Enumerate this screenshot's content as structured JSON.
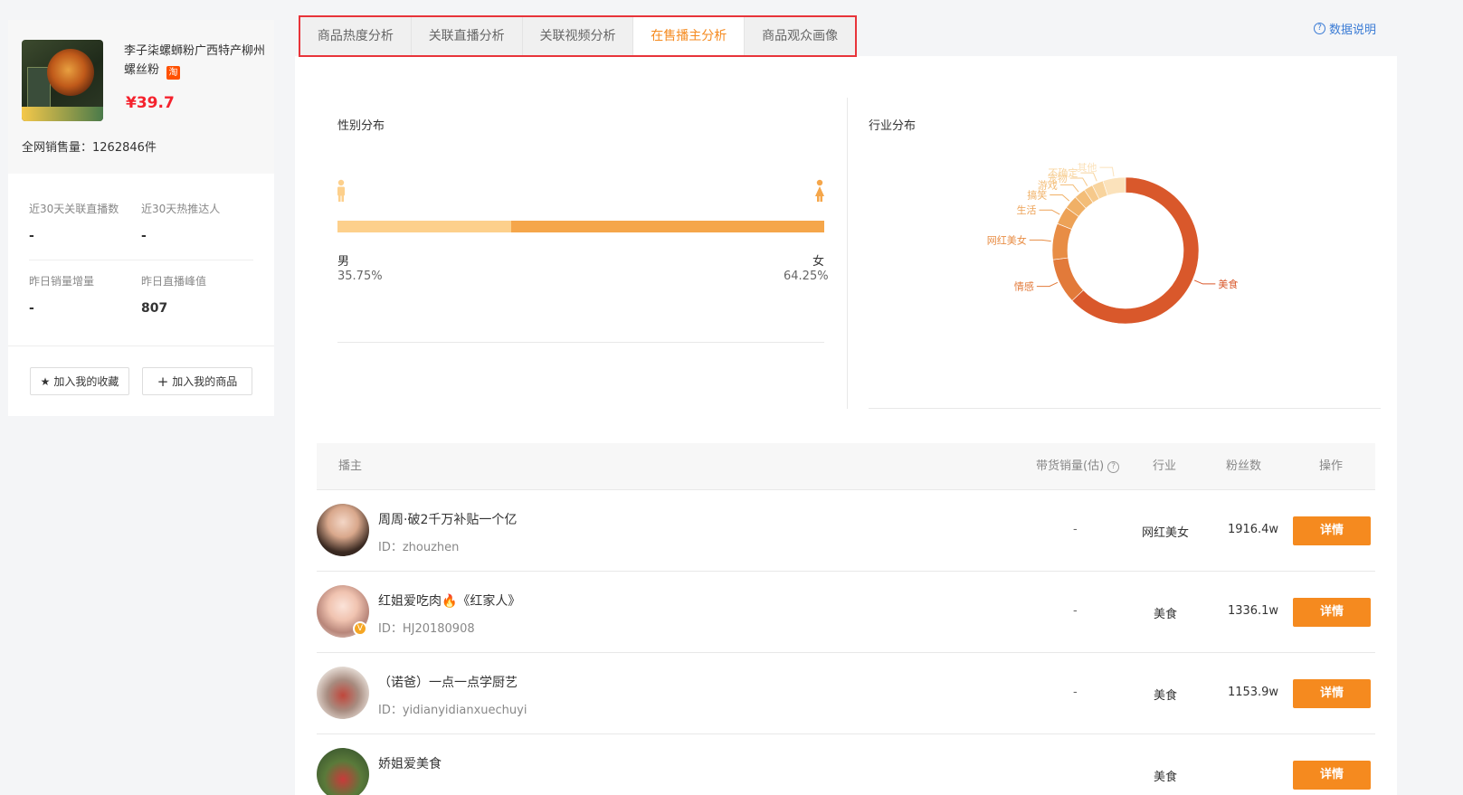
{
  "product": {
    "title": "李子柒螺蛳粉广西特产柳州螺丝粉",
    "platform_badge": "淘",
    "price": "¥39.7",
    "total_sales": "全网销售量：1262846件"
  },
  "stats": [
    {
      "label": "近30天关联直播数",
      "value": "-"
    },
    {
      "label": "近30天热推达人",
      "value": "-"
    },
    {
      "label": "昨日销量增量",
      "value": "-"
    },
    {
      "label": "昨日直播峰值",
      "value": "807"
    }
  ],
  "actions": {
    "favorite": "加入我的收藏",
    "add_product": "加入我的商品"
  },
  "tabs": [
    {
      "label": "商品热度分析",
      "active": false
    },
    {
      "label": "关联直播分析",
      "active": false
    },
    {
      "label": "关联视频分析",
      "active": false
    },
    {
      "label": "在售播主分析",
      "active": true
    },
    {
      "label": "商品观众画像",
      "active": false
    }
  ],
  "data_help": "数据说明",
  "gender": {
    "title": "性别分布",
    "male_label": "男",
    "female_label": "女",
    "male_pct": "35.75%",
    "female_pct": "64.25%"
  },
  "industry": {
    "title": "行业分布"
  },
  "chart_data": {
    "type": "pie",
    "title": "行业分布",
    "labels": [
      "美食",
      "情感",
      "网红美女",
      "生活",
      "搞笑",
      "游戏",
      "宠物",
      "不确定",
      "其他"
    ],
    "values": [
      63,
      10,
      8,
      4,
      3,
      2.5,
      2,
      2.5,
      5
    ],
    "colors": [
      "#d9582b",
      "#e27a3a",
      "#e88d45",
      "#eda257",
      "#f0b066",
      "#f3bd78",
      "#f6c98b",
      "#f8d49e",
      "#fbe2bb"
    ],
    "label_colors": [
      "#d9582b",
      "#e27a3a",
      "#e88d45",
      "#eda257",
      "#f0b066",
      "#f3bd78",
      "#f6c98b",
      "#f8d49e",
      "#fbe2bb"
    ]
  },
  "table": {
    "headers": {
      "anchor": "播主",
      "sales": "带货销量(估)",
      "industry": "行业",
      "fans": "粉丝数",
      "action": "操作"
    },
    "rows": [
      {
        "name": "周周·破2千万补贴一个亿",
        "id": "ID：zhouzhen",
        "sales": "-",
        "industry": "网红美女",
        "fans": "1916.4w",
        "action": "详情"
      },
      {
        "name": "红姐爱吃肉🔥《红家人》",
        "id": "ID：HJ20180908",
        "sales": "-",
        "industry": "美食",
        "fans": "1336.1w",
        "action": "详情"
      },
      {
        "name": "（诺爸）一点一点学厨艺",
        "id": "ID：yidianyidianxuechuyi",
        "sales": "-",
        "industry": "美食",
        "fans": "1153.9w",
        "action": "详情"
      },
      {
        "name": "娇姐爱美食",
        "id": "",
        "sales": "",
        "industry": "美食",
        "fans": "",
        "action": "详情"
      }
    ]
  }
}
